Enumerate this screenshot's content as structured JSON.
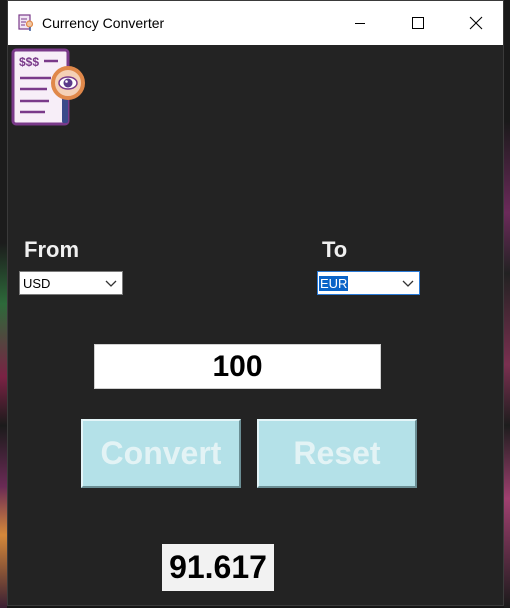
{
  "window": {
    "title": "Currency Converter"
  },
  "icons": {
    "app_title_icon": "document-magnifier-icon",
    "logo": "invoice-magnifier-icon",
    "minimize": "minimize-icon",
    "maximize": "maximize-icon",
    "close": "close-icon",
    "dropdown": "chevron-down-icon"
  },
  "logo": {
    "text": "$$$"
  },
  "from": {
    "label": "From",
    "selected": "USD"
  },
  "to": {
    "label": "To",
    "selected": "EUR"
  },
  "amount": {
    "value": "100"
  },
  "buttons": {
    "convert": "Convert",
    "reset": "Reset"
  },
  "result": {
    "value": "91.617"
  },
  "colors": {
    "background": "#232323",
    "button_bg": "#b4e1e8",
    "button_text": "#e3f3f5",
    "selection": "#0a64c8"
  }
}
